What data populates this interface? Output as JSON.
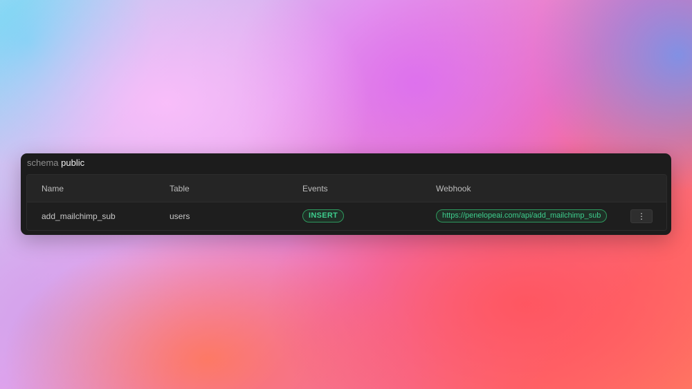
{
  "schema": {
    "label": "schema",
    "value": "public"
  },
  "table": {
    "columns": [
      "Name",
      "Table",
      "Events",
      "Webhook"
    ],
    "rows": [
      {
        "name": "add_mailchimp_sub",
        "table": "users",
        "events": "INSERT",
        "webhook": "https://penelopeai.com/api/add_mailchimp_sub",
        "menu_icon": "⋮"
      }
    ]
  },
  "colors": {
    "accent_green": "#3ecf8e",
    "panel_bg": "#1c1c1c"
  },
  "icons": {
    "row_menu": "more-vertical-icon"
  }
}
